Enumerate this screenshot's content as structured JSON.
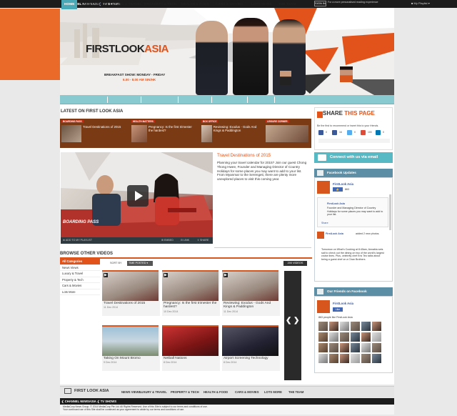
{
  "topbar": {
    "channel_link": "CHANNEL NEWSASIA",
    "shows_link": "TV SHOWS",
    "signin": "SIGN IN",
    "signin_message": "For a more personalised reading experience",
    "playlist": "My Playlist"
  },
  "header": {
    "logo_first": "FIRSTLOOK",
    "logo_second": "ASIA",
    "breakfast_label": "BREAKFAST SHOW: MONDAY - FRIDAY",
    "breakfast_time": "6.00 - 8.00 AM SIN/HK"
  },
  "nav": {
    "items": [
      "HOME",
      "NEWS VIEWS",
      "LUXURY & TRAVEL",
      "PROPERTY & TECH",
      "HEALTH & FOOD",
      "CARS & MOVIES",
      "LOTS MORE",
      "THE TEAM"
    ]
  },
  "latest": {
    "title": "LATEST ON FIRST LOOK ASIA",
    "cards": [
      {
        "tag": "BOARDING PASS",
        "text": "Travel Destinations of 2015"
      },
      {
        "tag": "HEALTH MATTERS",
        "text": "Pregnancy: Is the first trimester the hardest?"
      },
      {
        "tag": "BOX OFFICE",
        "text": "Reviewing: Exodus - Gods And Kings & Paddington"
      },
      {
        "tag": "LEISURE CORNER",
        "text": ""
      }
    ]
  },
  "featured": {
    "title": "Travel Destinations of 2015",
    "description": "Planning your travel calendar for 2015? Join our guest Chong Thong Hwee, Founder and Managing Director of Country Holidays for some places you may want to add to your list. From Myanmar to the Serengeti, there are plenty more unexplored places to visit this coming year.",
    "overlay_label": "BOARDING PASS",
    "add_playlist": "ADD TO MY PLAYLIST",
    "embed": "EMBED",
    "link": "LINK",
    "share": "SHARE"
  },
  "browse": {
    "title": "BROWSE OTHER VIDEOS",
    "categories": [
      "All Categories",
      "News Views",
      "Luxury & Travel",
      "Property & Tech",
      "Cars & Movies",
      "Lots More"
    ],
    "sort_label": "SORT BY",
    "sort_value": "TIME POSTED",
    "video_count": "200 VIDEOS",
    "videos": [
      {
        "title": "Travel Destinations of 2015",
        "date": "11 Dec 2014"
      },
      {
        "title": "Pregnancy: Is the first trimester the hardest?",
        "date": "10 Dec 2014"
      },
      {
        "title": "Reviewing: Exodus - Gods And Kings & Paddington",
        "date": "11 Dec 2014"
      },
      {
        "title": "Taking On Mount Bromo",
        "date": "9 Dec 2014"
      },
      {
        "title": "Netball Nations",
        "date": "8 Dec 2014"
      },
      {
        "title": "Airport Screening Technology",
        "date": "8 Dec 2014"
      }
    ]
  },
  "share": {
    "title_prefix": "SHARE",
    "title_suffix": "THIS PAGE",
    "subtitle": "Be the first to recommend or tweet this to your friends.",
    "counts": [
      "0",
      "16",
      "0",
      "100",
      "0"
    ]
  },
  "connect": {
    "label": "Connect with us via email"
  },
  "facebook": {
    "header": "Facebook Updates",
    "page_name": "FirstLook Asia",
    "like_count": "863",
    "post_author": "FirstLook Asia",
    "post_text": "Founder and Managing Director of Country Holidays for some places you may want to add to your list.",
    "share_label": "Share",
    "post2_author": "FirstLook Asia",
    "post2_meta": "added 2 new photos.",
    "post2_text": "Tomorrow on What's Cooking at 8:40am, Annabia sets sail to check out the dining on two of the world's largest cruise lines. Plus, celebrity chef Eric Teo talks about being a guest chef on a Chan Brothers"
  },
  "friends": {
    "header": "Our Friends on Facebook",
    "page_name": "FirstLook Asia",
    "like_label": "Like",
    "count_text": "863 people like FirstLook Asia"
  },
  "footer": {
    "logo": "FIRST LOOK ASIA",
    "items": [
      "NEWS VIEWS",
      "LUXURY & TRAVEL",
      "PROPERTY & TECH",
      "HEALTH & FOOD",
      "CARS & MOVIES",
      "LOTS MORE",
      "THE TEAM"
    ],
    "channel_link": "CHANNEL NEWSASIA",
    "shows_link": "TV SHOWS",
    "copyright": "MediaCorp News Group. © 2014 MediaCorp Pte Ltd. All Rights Reserved. Use of this Site is subject to our terms and conditions of use.",
    "terms": "Your continued use of this Site shall be construed as your agreement to abide by our terms and conditions of use."
  },
  "colors": {
    "accent": "#e2531b",
    "nav": "#89cad1",
    "dark": "#1c1c1c"
  }
}
